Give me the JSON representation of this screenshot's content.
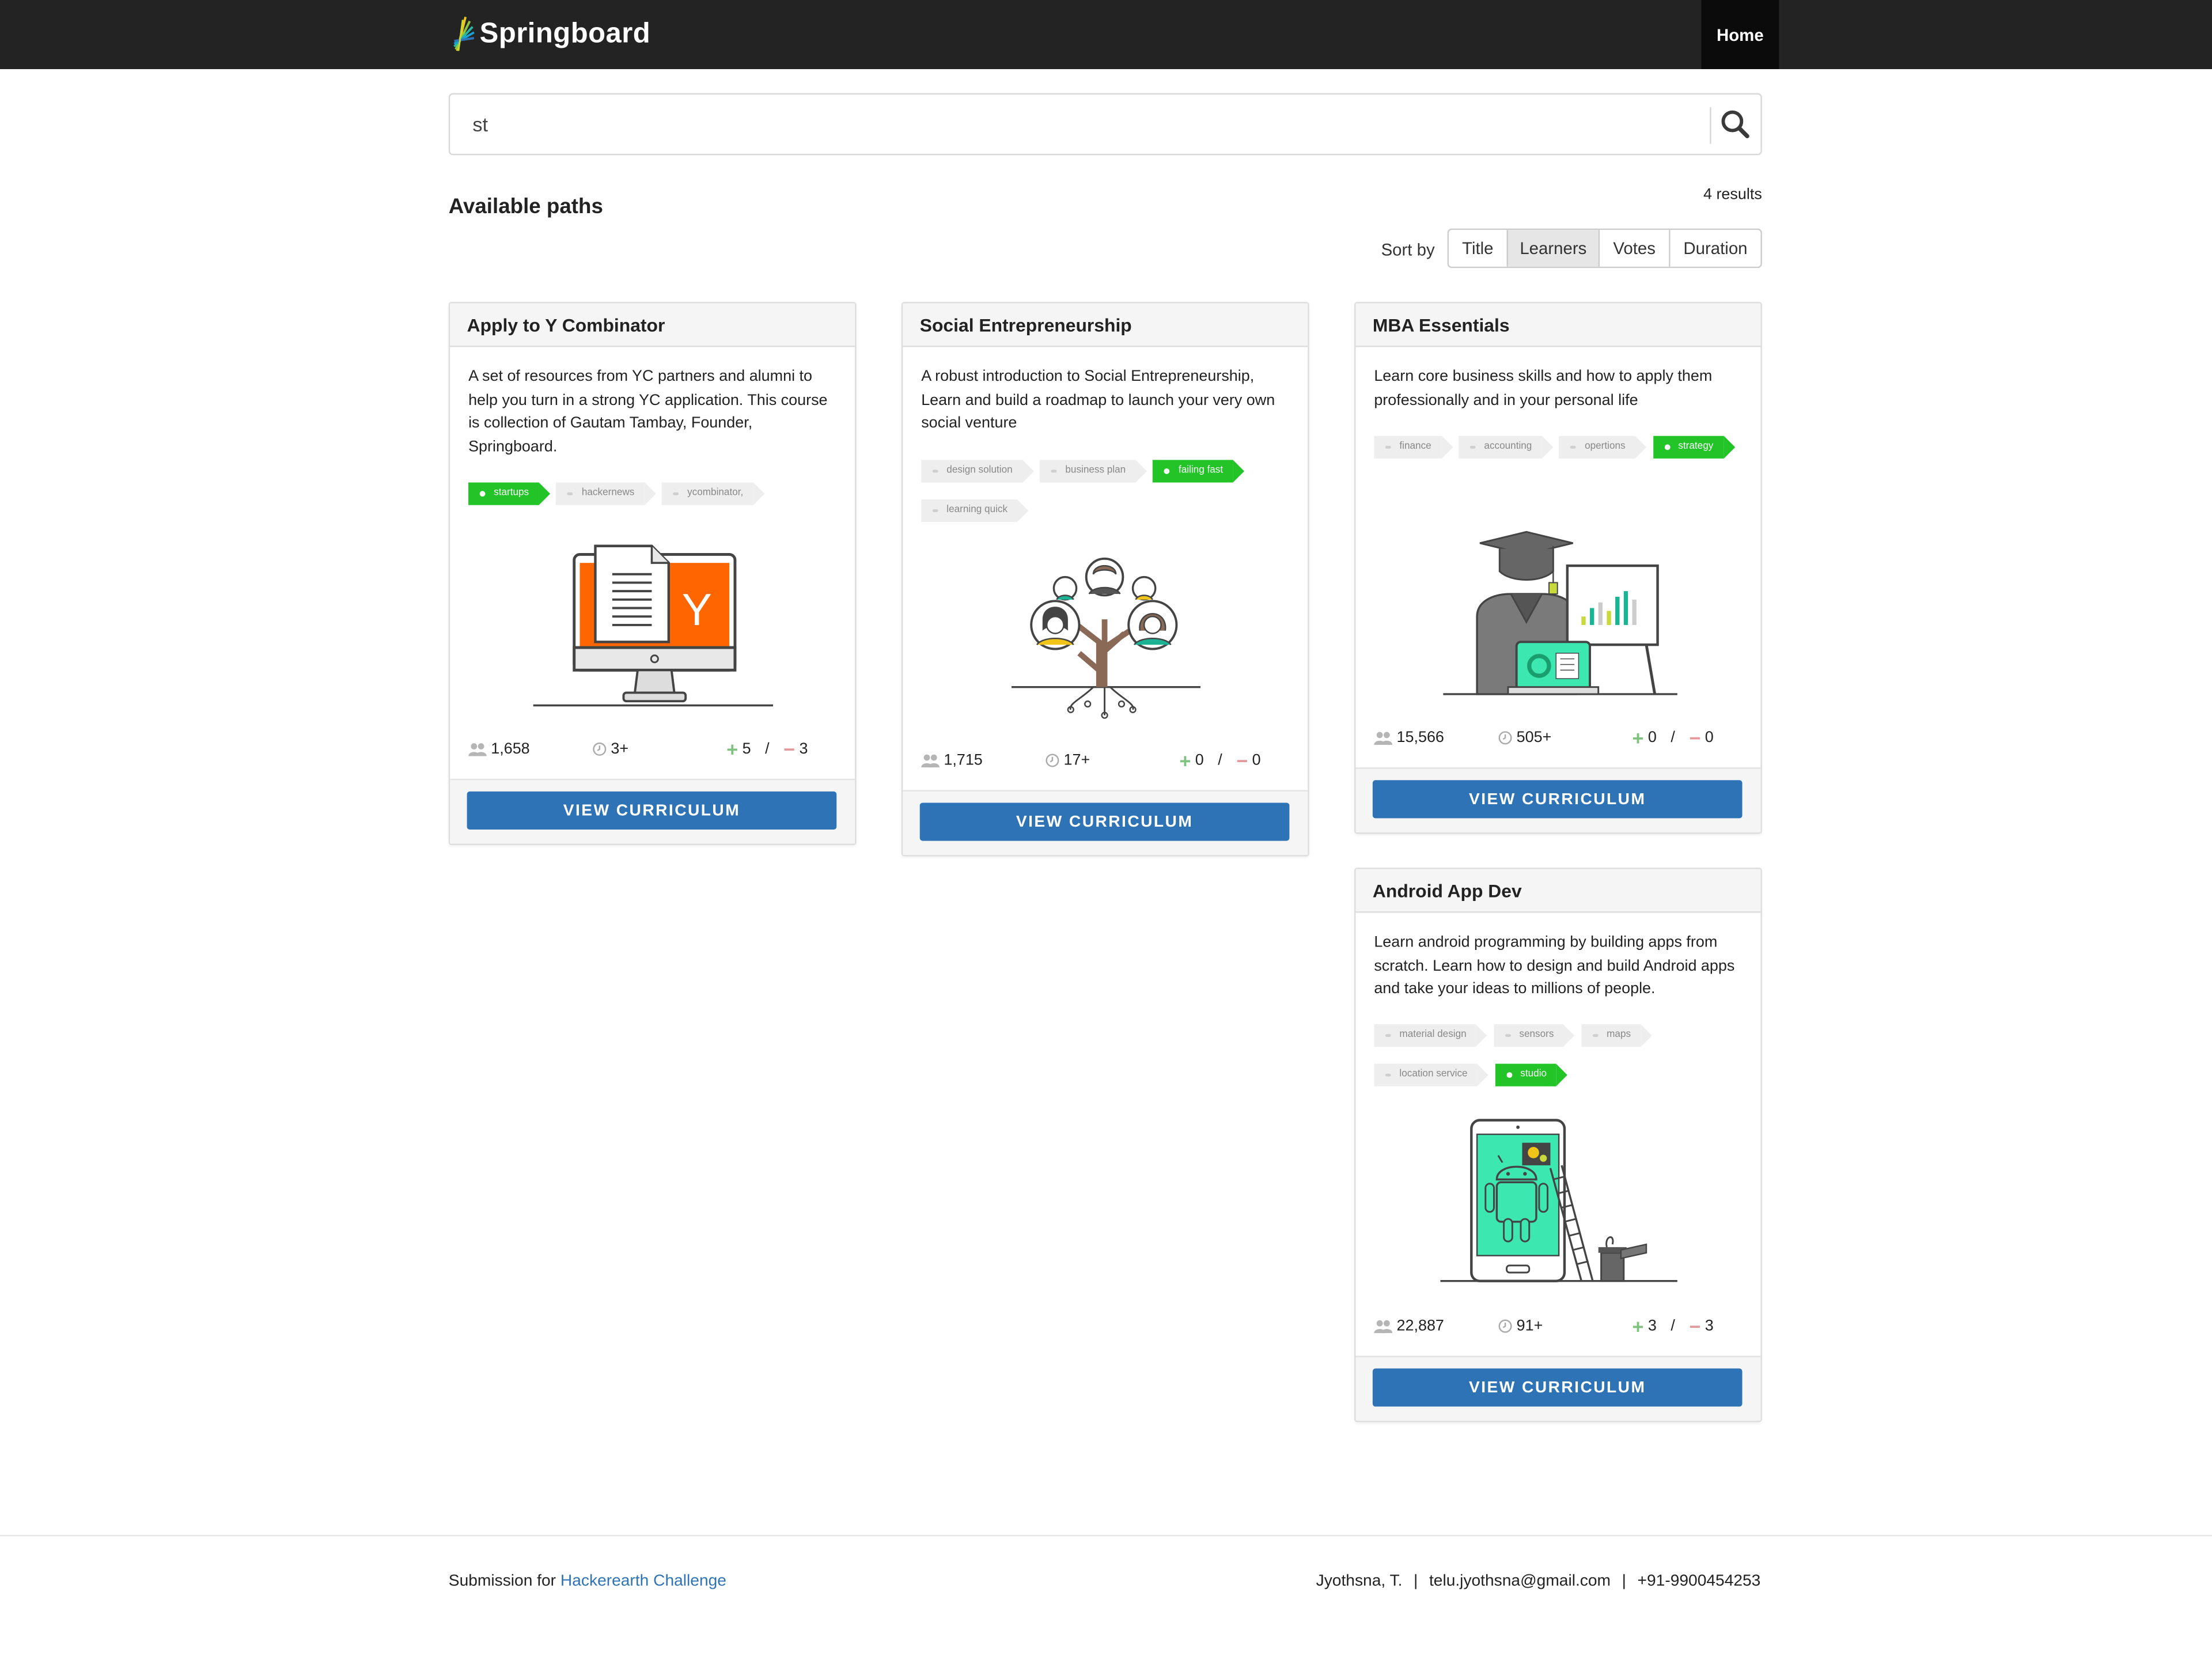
{
  "nav": {
    "brand": "Springboard",
    "home": "Home"
  },
  "search": {
    "value": "st"
  },
  "results": {
    "count": "4 results",
    "title": "Available paths"
  },
  "sort": {
    "label": "Sort by",
    "options": [
      "Title",
      "Learners",
      "Votes",
      "Duration"
    ],
    "selected": "Learners"
  },
  "cards": [
    {
      "title": "Apply to Y Combinator",
      "description": "A set of resources from YC partners and alumni to help you turn in a strong YC application. This course is collection of Gautam Tambay, Founder, Springboard.",
      "tags": [
        {
          "label": "startups",
          "active": true
        },
        {
          "label": "hackernews",
          "active": false
        },
        {
          "label": "ycombinator,",
          "active": false
        }
      ],
      "learners": "1,658",
      "duration": "3+",
      "upvotes": "5",
      "slash": "/",
      "downvotes": "3",
      "button": "VIEW CURRICULUM"
    },
    {
      "title": "Social Entrepreneurship",
      "description": "A robust introduction to Social Entrepreneurship, Learn and build a roadmap to launch your very own social venture",
      "tags": [
        {
          "label": "design solution",
          "active": false
        },
        {
          "label": "business plan",
          "active": false
        },
        {
          "label": "failing fast",
          "active": true
        },
        {
          "label": "learning quick",
          "active": false
        }
      ],
      "learners": "1,715",
      "duration": "17+",
      "upvotes": "0",
      "slash": "/",
      "downvotes": "0",
      "button": "VIEW CURRICULUM"
    },
    {
      "title": "MBA Essentials",
      "description": "Learn core business skills and how to apply them professionally and in your personal life",
      "tags": [
        {
          "label": "finance",
          "active": false
        },
        {
          "label": "accounting",
          "active": false
        },
        {
          "label": "opertions",
          "active": false
        },
        {
          "label": "strategy",
          "active": true
        }
      ],
      "learners": "15,566",
      "duration": "505+",
      "upvotes": "0",
      "slash": "/",
      "downvotes": "0",
      "button": "VIEW CURRICULUM"
    },
    {
      "title": "Android App Dev",
      "description": "Learn android programming by building apps from scratch. Learn how to design and build Android apps and take your ideas to millions of people.",
      "tags": [
        {
          "label": "material design",
          "active": false
        },
        {
          "label": "sensors",
          "active": false
        },
        {
          "label": "maps",
          "active": false
        },
        {
          "label": "location service",
          "active": false
        },
        {
          "label": "studio",
          "active": true
        }
      ],
      "learners": "22,887",
      "duration": "91+",
      "upvotes": "3",
      "slash": "/",
      "downvotes": "3",
      "button": "VIEW CURRICULUM"
    }
  ],
  "footer": {
    "prefix": "Submission for",
    "link": "Hackerearth Challenge",
    "name": "Jyothsna, T.",
    "pipe": "|",
    "email": "telu.jyothsna@gmail.com",
    "phone": "+91-9900454253"
  },
  "colors": {
    "nav_bg": "#232323",
    "tag_active": "#22c427",
    "button": "#2f73b7",
    "link": "#2f73b7"
  },
  "icons": [
    "springboard-logo-icon",
    "search-icon",
    "learners-icon",
    "clock-icon",
    "upvote-icon",
    "downvote-icon"
  ]
}
